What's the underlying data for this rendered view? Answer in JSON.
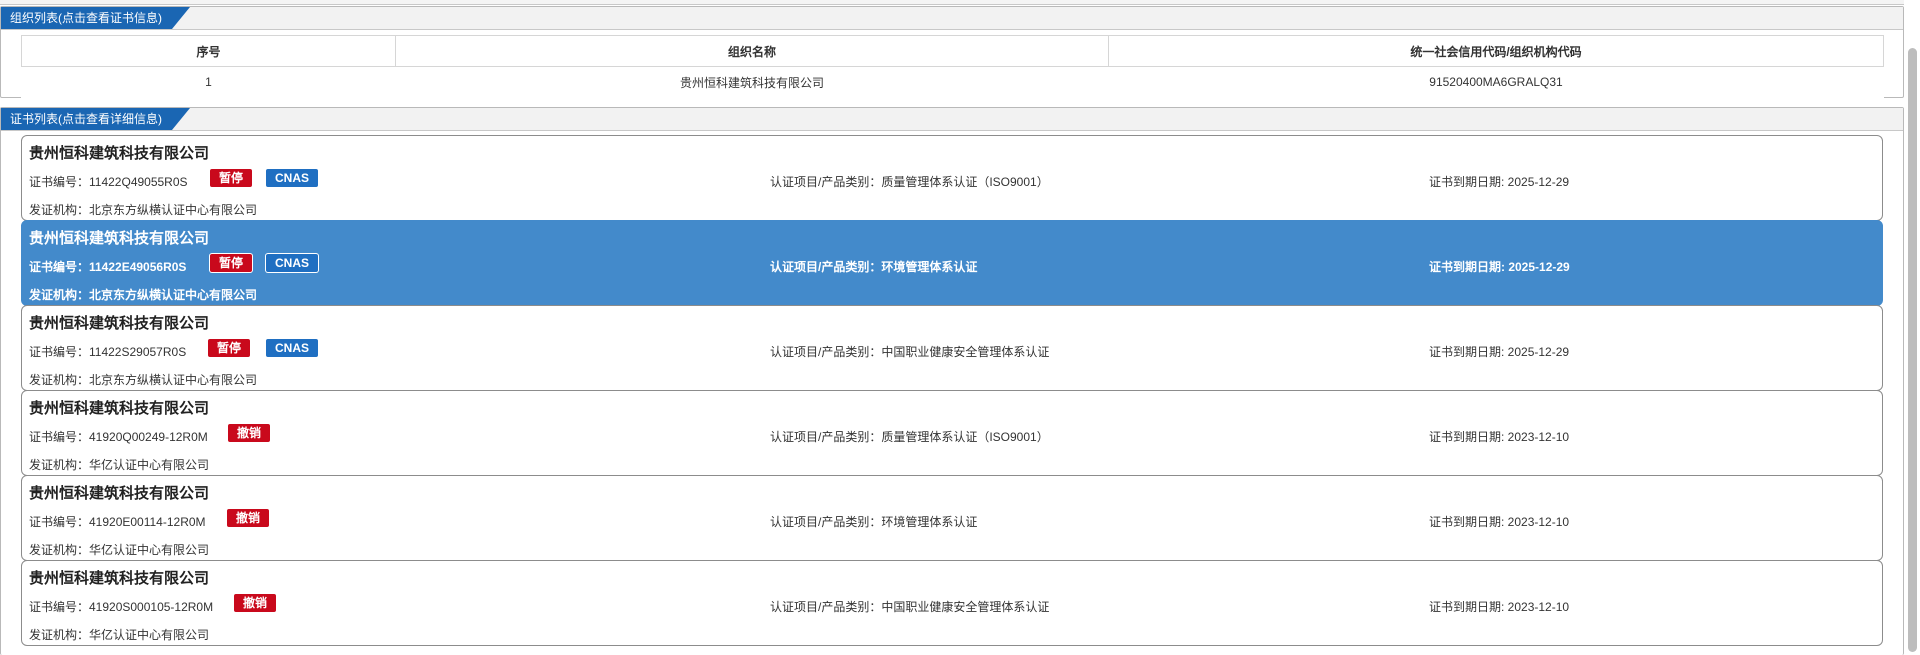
{
  "org_panel": {
    "tab_label": "组织列表(点击查看证书信息)",
    "headers": [
      "序号",
      "组织名称",
      "统一社会信用代码/组织机构代码"
    ],
    "rows": [
      {
        "index": "1",
        "name": "贵州恒科建筑科技有限公司",
        "code": "91520400MA6GRALQ31"
      }
    ]
  },
  "cert_panel": {
    "tab_label": "证书列表(点击查看详细信息)",
    "certs": [
      {
        "company": "贵州恒科建筑科技有限公司",
        "number": "证书编号：11422Q49055R0S",
        "status": "暂停",
        "cnas": "CNAS",
        "project": "认证项目/产品类别：质量管理体系认证（ISO9001）",
        "expiry": "证书到期日期: 2025-12-29",
        "issuer": "发证机构：北京东方纵横认证中心有限公司"
      },
      {
        "company": "贵州恒科建筑科技有限公司",
        "number": "证书编号：11422E49056R0S",
        "status": "暂停",
        "cnas": "CNAS",
        "project": "认证项目/产品类别：环境管理体系认证",
        "expiry": "证书到期日期: 2025-12-29",
        "issuer": "发证机构：北京东方纵横认证中心有限公司"
      },
      {
        "company": "贵州恒科建筑科技有限公司",
        "number": "证书编号：11422S29057R0S",
        "status": "暂停",
        "cnas": "CNAS",
        "project": "认证项目/产品类别：中国职业健康安全管理体系认证",
        "expiry": "证书到期日期: 2025-12-29",
        "issuer": "发证机构：北京东方纵横认证中心有限公司"
      },
      {
        "company": "贵州恒科建筑科技有限公司",
        "number": "证书编号：41920Q00249-12R0M",
        "status": "撤销",
        "cnas": "",
        "project": "认证项目/产品类别：质量管理体系认证（ISO9001）",
        "expiry": "证书到期日期: 2023-12-10",
        "issuer": "发证机构：华亿认证中心有限公司"
      },
      {
        "company": "贵州恒科建筑科技有限公司",
        "number": "证书编号：41920E00114-12R0M",
        "status": "撤销",
        "cnas": "",
        "project": "认证项目/产品类别：环境管理体系认证",
        "expiry": "证书到期日期: 2023-12-10",
        "issuer": "发证机构：华亿认证中心有限公司"
      },
      {
        "company": "贵州恒科建筑科技有限公司",
        "number": "证书编号：41920S000105-12R0M",
        "status": "撤销",
        "cnas": "",
        "project": "认证项目/产品类别：中国职业健康安全管理体系认证",
        "expiry": "证书到期日期: 2023-12-10",
        "issuer": "发证机构：华亿认证中心有限公司"
      }
    ]
  },
  "colors": {
    "tab_blue": "#1a66b3",
    "selected_row": "#438acb",
    "status_red": "#c9091c",
    "cnas_blue": "#1f6fc2"
  }
}
